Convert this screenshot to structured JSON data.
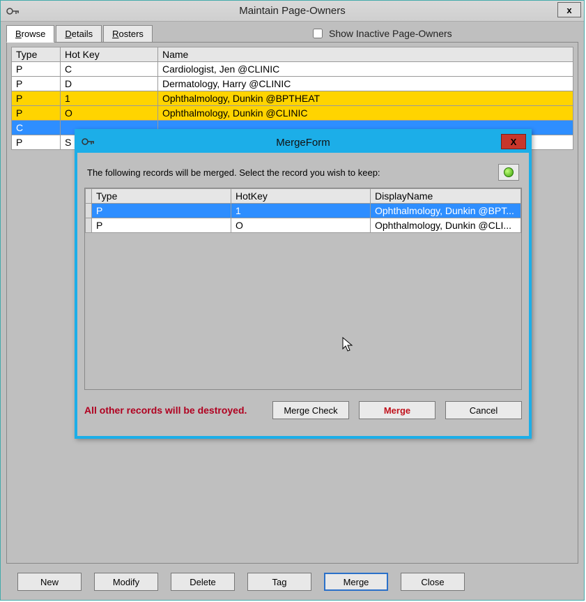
{
  "window": {
    "title": "Maintain Page-Owners",
    "close_label": "x"
  },
  "tabs": {
    "browse": "Browse",
    "details": "Details",
    "rosters": "Rosters"
  },
  "show_inactive_label": "Show Inactive Page-Owners",
  "grid": {
    "headers": {
      "type": "Type",
      "hotkey": "Hot Key",
      "name": "Name"
    },
    "rows": [
      {
        "type": "P",
        "hotkey": "C",
        "name": "Cardiologist, Jen @CLINIC",
        "style": "normal"
      },
      {
        "type": "P",
        "hotkey": "D",
        "name": "Dermatology, Harry @CLINIC",
        "style": "normal"
      },
      {
        "type": "P",
        "hotkey": "1",
        "name": "Ophthalmology, Dunkin @BPTHEAT",
        "style": "yellow"
      },
      {
        "type": "P",
        "hotkey": "O",
        "name": "Ophthalmology, Dunkin @CLINIC",
        "style": "yellow"
      },
      {
        "type": "C",
        "hotkey": "",
        "name": "",
        "style": "blue"
      },
      {
        "type": "P",
        "hotkey": "S",
        "name": "",
        "style": "normal"
      }
    ]
  },
  "buttons": {
    "new": "New",
    "modify": "Modify",
    "delete": "Delete",
    "tag": "Tag",
    "merge": "Merge",
    "close": "Close"
  },
  "merge_dialog": {
    "title": "MergeForm",
    "close_label": "X",
    "instruction": "The following records will be merged. Select the record you wish to keep:",
    "headers": {
      "type": "Type",
      "hotkey": "HotKey",
      "displayname": "DisplayName"
    },
    "rows": [
      {
        "type": "P",
        "hotkey": "1",
        "displayname": "Ophthalmology, Dunkin @BPT...",
        "selected": true
      },
      {
        "type": "P",
        "hotkey": "O",
        "displayname": "Ophthalmology, Dunkin @CLI...",
        "selected": false
      }
    ],
    "warning": "All other records will be destroyed.",
    "mergecheck": "Merge Check",
    "merge": "Merge",
    "cancel": "Cancel"
  }
}
